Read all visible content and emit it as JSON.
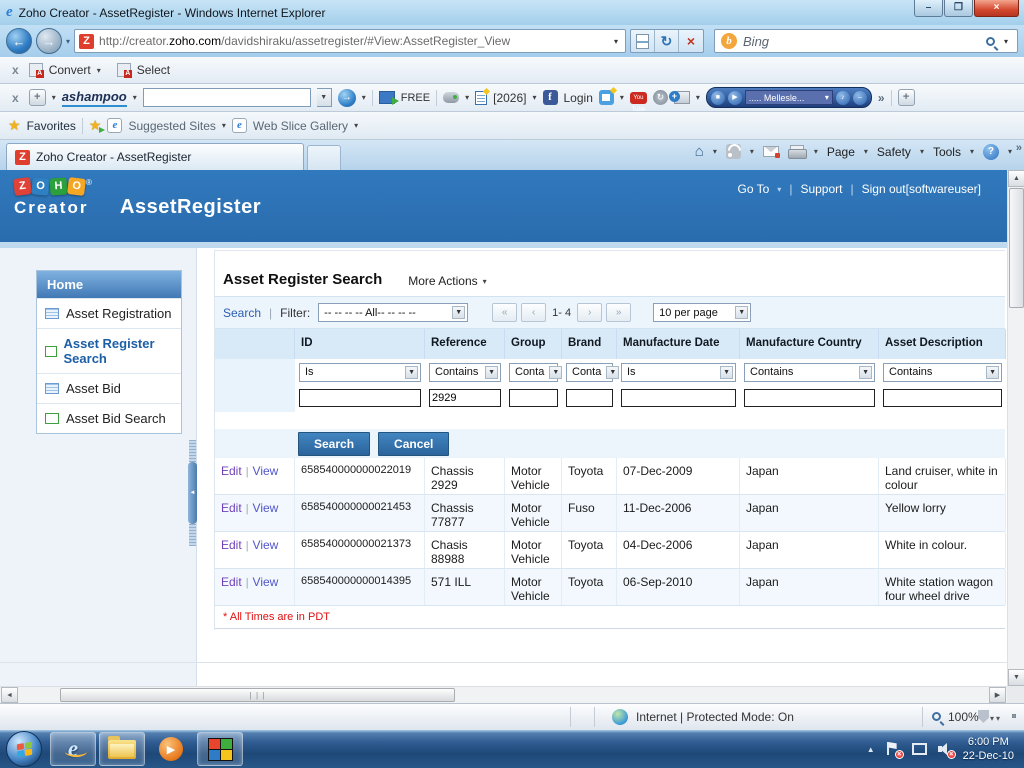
{
  "window": {
    "title": "Zoho Creator - AssetRegister - Windows Internet Explorer",
    "controls": {
      "minimize": "–",
      "maximize": "❐",
      "close": "×"
    }
  },
  "browser": {
    "url_pre": "http://creator.",
    "url_domain": "zoho.com",
    "url_path": "/davidshiraku/assetregister/#View:AssetRegister_View",
    "search_engine": "Bing"
  },
  "toolbars": {
    "convert": {
      "close": "x",
      "convert": "Convert",
      "select": "Select"
    },
    "ashampoo": {
      "close": "x",
      "add": "+",
      "brand": "ashampoo",
      "free": "FREE",
      "doc": "[2026]",
      "login": "Login",
      "youtube": "You Tube",
      "media": "..... Mellesle...",
      "overflow": "»",
      "plus": "+"
    },
    "favorites": {
      "favorites": "Favorites",
      "suggested": "Suggested Sites",
      "webslice": "Web Slice Gallery"
    },
    "tab": {
      "active": "Zoho Creator - AssetRegister"
    },
    "command": {
      "page": "Page",
      "safety": "Safety",
      "tools": "Tools",
      "help": "?",
      "overflow": "»"
    }
  },
  "app": {
    "logo_letters": [
      "Z",
      "O",
      "H",
      "O"
    ],
    "logo_reg": "®",
    "logo_sub": "Creator",
    "title": "AssetRegister",
    "nav": {
      "goto": "Go To",
      "support": "Support",
      "signout": "Sign out[softwareuser]"
    }
  },
  "sidebar": {
    "header": "Home",
    "items": [
      {
        "label": "Asset Registration"
      },
      {
        "label": "Asset Register Search"
      },
      {
        "label": "Asset Bid"
      },
      {
        "label": "Asset Bid Search"
      }
    ]
  },
  "main": {
    "title": "Asset Register Search",
    "more_actions": "More Actions",
    "search_link": "Search",
    "filter_label": "Filter:",
    "filter_value": "-- -- -- -- All-- -- -- --",
    "pagination": {
      "first": "«",
      "prev": "‹",
      "range": "1- 4",
      "next": "›",
      "last": "»",
      "per_page": "10 per page"
    },
    "buttons": {
      "search": "Search",
      "cancel": "Cancel"
    },
    "footnote": "* All Times are in PDT",
    "table": {
      "headers": [
        "ID",
        "Reference",
        "Group",
        "Brand",
        "Manufacture Date",
        "Manufacture Country",
        "Asset Description"
      ],
      "ops": [
        "Is",
        "Contains",
        "Conta",
        "Conta",
        "Is",
        "Contains",
        "Contains"
      ],
      "filter_values": [
        "",
        "2929",
        "",
        "",
        "",
        "",
        ""
      ],
      "rows": [
        {
          "edit": "Edit",
          "view": "View",
          "id": "658540000000022019",
          "reference": "Chassis 2929",
          "group": "Motor Vehicle",
          "brand": "Toyota",
          "date": "07-Dec-2009",
          "country": "Japan",
          "description": "Land cruiser, white in colour"
        },
        {
          "edit": "Edit",
          "view": "View",
          "id": "658540000000021453",
          "reference": "Chassis 77877",
          "group": "Motor Vehicle",
          "brand": "Fuso",
          "date": "11-Dec-2006",
          "country": "Japan",
          "description": "Yellow lorry"
        },
        {
          "edit": "Edit",
          "view": "View",
          "id": "658540000000021373",
          "reference": "Chasis 88988",
          "group": "Motor Vehicle",
          "brand": "Toyota",
          "date": "04-Dec-2006",
          "country": "Japan",
          "description": "White in colour."
        },
        {
          "edit": "Edit",
          "view": "View",
          "id": "658540000000014395",
          "reference": "571 ILL",
          "group": "Motor Vehicle",
          "brand": "Toyota",
          "date": "06-Sep-2010",
          "country": "Japan",
          "description": "White station wagon four wheel drive"
        }
      ]
    }
  },
  "status": {
    "zone": "Internet | Protected Mode: On",
    "zoom": "100%"
  },
  "taskbar": {
    "time": "6:00 PM",
    "date": "22-Dec-10"
  },
  "icons": {
    "caret": "▼",
    "caret_small": "▾",
    "back": "←",
    "forward": "→",
    "refresh": "↻",
    "stop": "×",
    "star": "★",
    "home": "⌂",
    "up": "▲",
    "down": "▼",
    "left": "◄",
    "play": "▶",
    "stop_sq": "■",
    "note": "♪",
    "minus": "–",
    "grip": "| | |",
    "pipe": "|",
    "x_badge": "×",
    "ie_e": "e",
    "zoho_z": "Z",
    "bing_b": "b"
  },
  "colors": {
    "header_blue": "#2d73b6",
    "button_blue": "#2c649c",
    "link_blue": "#2a5db0",
    "note_red": "#e01010",
    "taskbar_blue": "#1e4878"
  }
}
